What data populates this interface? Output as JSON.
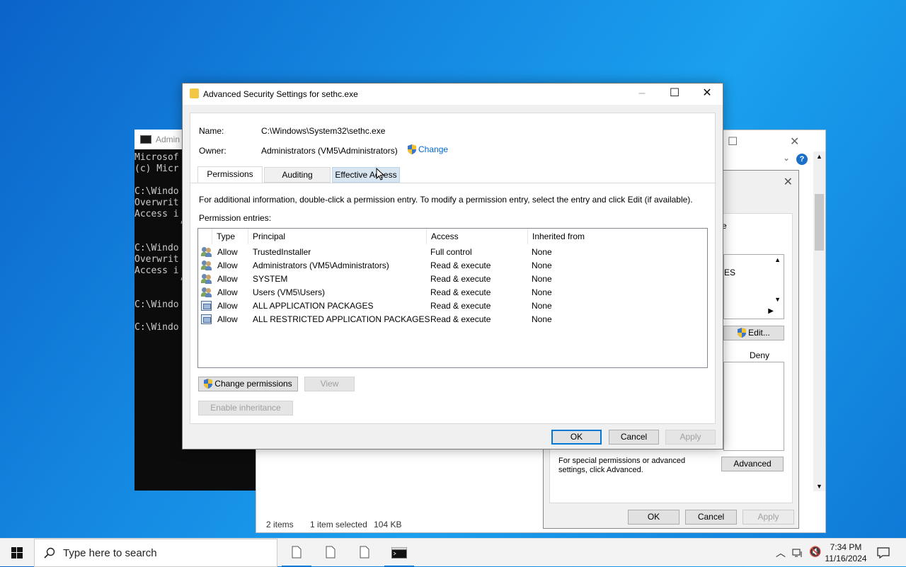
{
  "cmd": {
    "title": "Admin",
    "lines": "Microsof\n(c) Micr\n\nC:\\Windo\nOverwrit\nAccess i\n        ’\n\nC:\\Windo\nOverwrit\nAccess i\n        ’\n\nC:\\Windo\n\nC:\\Windo"
  },
  "explorer": {
    "status_items": "2 items",
    "status_selected": "1 item selected",
    "status_size": "104 KB",
    "help": "?"
  },
  "props_dialog": {
    "partial_label_e": "e",
    "list_fragment": "ES",
    "edit_button": "Edit...",
    "deny_label": "Deny",
    "special_text": "For special permissions or advanced settings, click Advanced.",
    "advanced_button": "Advanced",
    "ok_button": "OK",
    "cancel_button": "Cancel",
    "apply_button": "Apply"
  },
  "dialog": {
    "title": "Advanced Security Settings for sethc.exe",
    "name_label": "Name:",
    "name_value": "C:\\Windows\\System32\\sethc.exe",
    "owner_label": "Owner:",
    "owner_value": "Administrators (VM5\\Administrators)",
    "owner_change_link": "Change",
    "tabs": [
      {
        "label": "Permissions",
        "active": true
      },
      {
        "label": "Auditing",
        "active": false
      },
      {
        "label": "Effective Access",
        "active": false
      }
    ],
    "info_text": "For additional information, double-click a permission entry. To modify a permission entry, select the entry and click Edit (if available).",
    "entries_label": "Permission entries:",
    "columns": [
      "Type",
      "Principal",
      "Access",
      "Inherited from"
    ],
    "rows": [
      {
        "icon": "user-group-icon",
        "type": "Allow",
        "principal": "TrustedInstaller",
        "access": "Full control",
        "inherited": "None"
      },
      {
        "icon": "user-group-icon",
        "type": "Allow",
        "principal": "Administrators (VM5\\Administrators)",
        "access": "Read & execute",
        "inherited": "None"
      },
      {
        "icon": "user-group-icon",
        "type": "Allow",
        "principal": "SYSTEM",
        "access": "Read & execute",
        "inherited": "None"
      },
      {
        "icon": "user-group-icon",
        "type": "Allow",
        "principal": "Users (VM5\\Users)",
        "access": "Read & execute",
        "inherited": "None"
      },
      {
        "icon": "app-package-icon",
        "type": "Allow",
        "principal": "ALL APPLICATION PACKAGES",
        "access": "Read & execute",
        "inherited": "None"
      },
      {
        "icon": "app-package-icon",
        "type": "Allow",
        "principal": "ALL RESTRICTED APPLICATION PACKAGES",
        "access": "Read & execute",
        "inherited": "None"
      }
    ],
    "change_permissions_button": "Change permissions",
    "view_button": "View",
    "enable_inheritance_button": "Enable inheritance",
    "ok_button": "OK",
    "cancel_button": "Cancel",
    "apply_button": "Apply"
  },
  "taskbar": {
    "search_placeholder": "Type here to search",
    "time": "7:34 PM",
    "date": "11/16/2024"
  },
  "colors": {
    "accent": "#0078d7",
    "link": "#0066cc",
    "desktop": "#1589e2"
  }
}
